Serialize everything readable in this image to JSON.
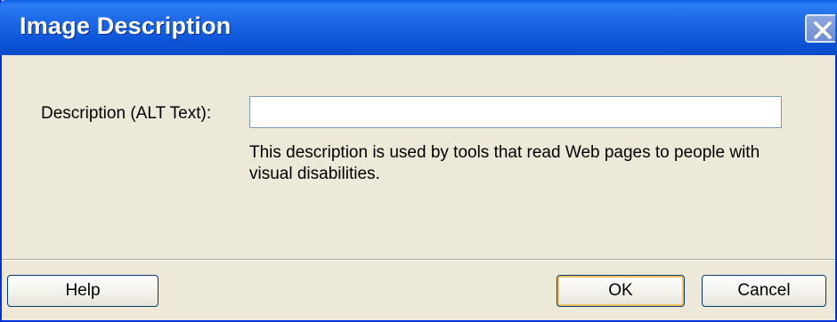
{
  "window": {
    "title": "Image Description",
    "colors": {
      "titlebar": "#0a52d6",
      "body": "#ece9d8",
      "frame": "#0831d9"
    }
  },
  "titlebar_controls": {
    "close_icon": "close-icon"
  },
  "form": {
    "description_label": "Description (ALT Text):",
    "description_value": "",
    "help_text": "This description is used by tools that read Web pages to people with visual disabilities."
  },
  "buttons": {
    "help": "Help",
    "ok": "OK",
    "cancel": "Cancel"
  }
}
